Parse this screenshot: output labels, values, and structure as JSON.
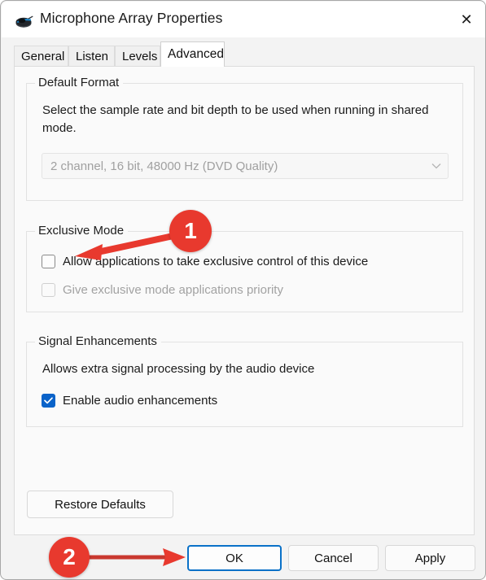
{
  "window": {
    "title": "Microphone Array Properties",
    "icon": "microphone-device-icon",
    "close_label": "✕"
  },
  "tabs": [
    {
      "label": "General",
      "active": false
    },
    {
      "label": "Listen",
      "active": false
    },
    {
      "label": "Levels",
      "active": false
    },
    {
      "label": "Advanced",
      "active": true
    }
  ],
  "groups": {
    "default_format": {
      "legend": "Default Format",
      "description": "Select the sample rate and bit depth to be used when running in shared mode.",
      "dropdown": {
        "value": "2 channel, 16 bit, 48000 Hz (DVD Quality)",
        "disabled": true,
        "chevron": "chevron-down-icon"
      }
    },
    "exclusive_mode": {
      "legend": "Exclusive Mode",
      "checkbox_allow": {
        "label": "Allow applications to take exclusive control of this device",
        "checked": false,
        "disabled": false
      },
      "checkbox_priority": {
        "label": "Give exclusive mode applications priority",
        "checked": false,
        "disabled": true
      }
    },
    "signal_enhancements": {
      "legend": "Signal Enhancements",
      "description": "Allows extra signal processing by the audio device",
      "checkbox_enable": {
        "label": "Enable audio enhancements",
        "checked": true,
        "disabled": false
      }
    }
  },
  "buttons": {
    "restore_defaults": "Restore Defaults",
    "ok": "OK",
    "cancel": "Cancel",
    "apply": "Apply"
  },
  "annotations": [
    {
      "number": "1",
      "target": "allow-exclusive-control-checkbox"
    },
    {
      "number": "2",
      "target": "ok-button"
    }
  ],
  "colors": {
    "accent_blue": "#0a63c9",
    "focus_blue": "#0a71c8",
    "annotation_red": "#e8392e",
    "panel_bg": "#fafafa",
    "window_bg": "#f3f3f3"
  }
}
